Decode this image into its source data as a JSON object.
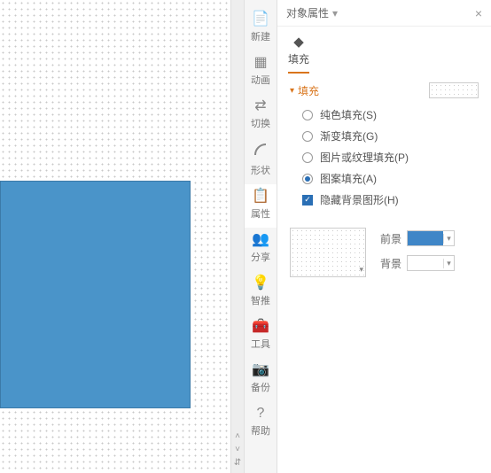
{
  "panel": {
    "title": "对象属性",
    "close": "×"
  },
  "sidebar": {
    "items": [
      {
        "label": "新建"
      },
      {
        "label": "动画"
      },
      {
        "label": "切换"
      },
      {
        "label": "形状"
      },
      {
        "label": "属性"
      },
      {
        "label": "分享"
      },
      {
        "label": "智推"
      },
      {
        "label": "工具"
      },
      {
        "label": "备份"
      },
      {
        "label": "帮助"
      }
    ]
  },
  "tabs": {
    "fill": "填充"
  },
  "section": {
    "title": "填充"
  },
  "fill_options": {
    "solid": "纯色填充(S)",
    "gradient": "渐变填充(G)",
    "picture": "图片或纹理填充(P)",
    "pattern": "图案填充(A)",
    "hide_bg": "隐藏背景图形(H)",
    "selected": "pattern",
    "hide_bg_checked": true
  },
  "colors": {
    "fg_label": "前景",
    "fg_value": "#3f86c7",
    "bg_label": "背景",
    "bg_value": "#ffffff"
  }
}
